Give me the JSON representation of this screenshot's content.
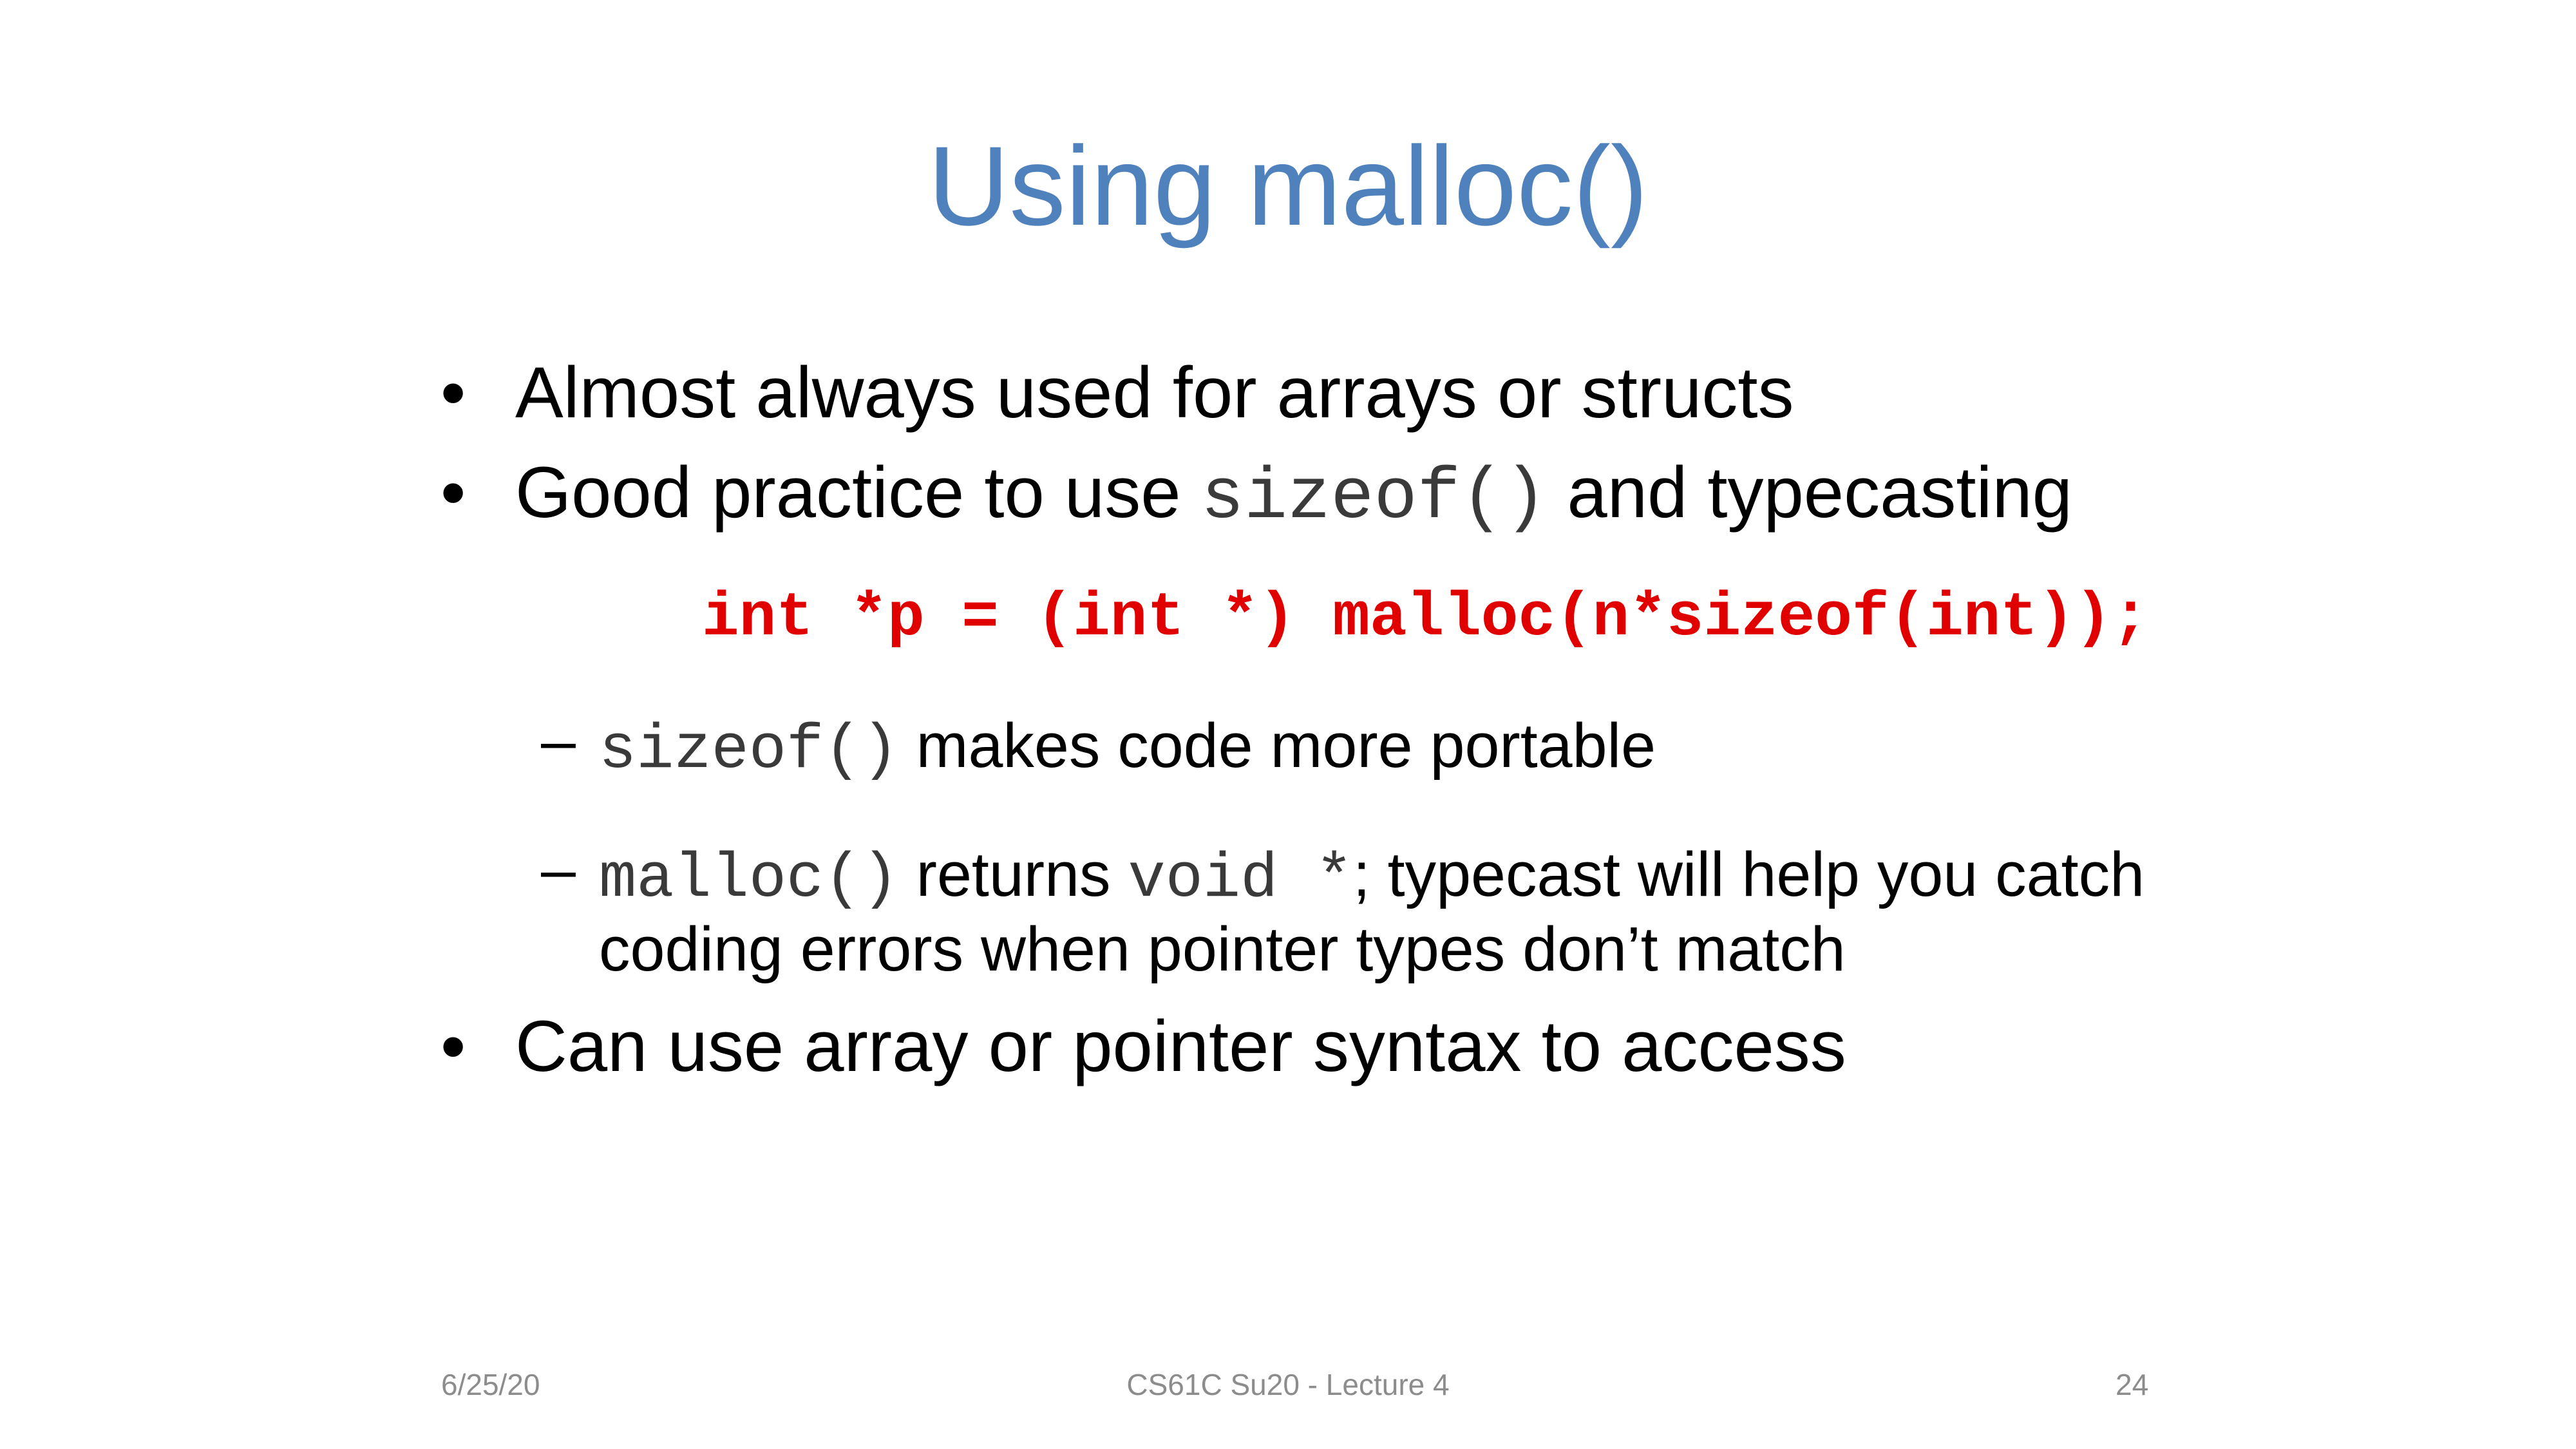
{
  "slide": {
    "title": "Using malloc()",
    "bullets": [
      {
        "text": "Almost always used for arrays or structs"
      },
      {
        "pre": "Good practice to use ",
        "code": "sizeof()",
        "post": " and typecasting"
      },
      {
        "text": "Can use array or pointer syntax to access"
      }
    ],
    "code_line": "int *p = (int *) malloc(n*sizeof(int));",
    "sub_bullets": [
      {
        "dash": "–",
        "code": "sizeof()",
        "text": " makes code more portable"
      },
      {
        "dash": "–",
        "code": "malloc()",
        "text1": " returns ",
        "code2": "void *",
        "text2": "; typecast will help you catch",
        "line2": "coding errors when pointer types don’t match"
      }
    ],
    "bullet_symbol": "•"
  },
  "footer": {
    "date": "6/25/20",
    "course": "CS61C Su20 - Lecture 4",
    "page": "24"
  },
  "colors": {
    "title": "#4f81bd",
    "code": "#e00000",
    "footer": "#8c8c8c"
  }
}
